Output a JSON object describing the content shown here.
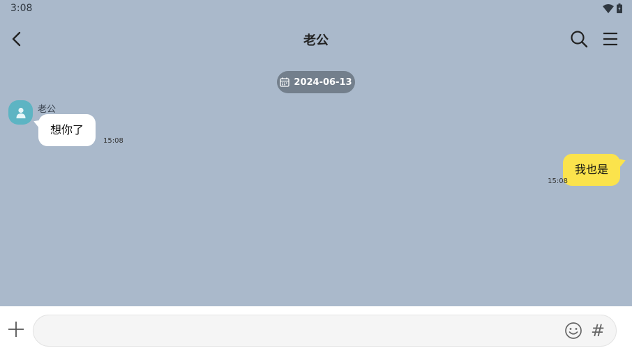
{
  "status_bar": {
    "time": "3:08"
  },
  "header": {
    "title": "老公"
  },
  "chat": {
    "date": "2024-06-13",
    "messages": [
      {
        "direction": "incoming",
        "sender": "老公",
        "text": "想你了",
        "time": "15:08"
      },
      {
        "direction": "outgoing",
        "text": "我也是",
        "time": "15:08"
      }
    ]
  },
  "input": {
    "value": "",
    "placeholder": "",
    "hash_label": "#"
  },
  "icons": {
    "back": "chevron-left-icon",
    "search": "search-icon",
    "menu": "menu-icon",
    "calendar": "calendar-icon",
    "avatar": "person-icon",
    "plus": "plus-icon",
    "emoji": "emoji-icon",
    "wifi": "wifi-icon",
    "battery": "battery-icon"
  },
  "colors": {
    "chat_background": "#aab9cb",
    "incoming_bubble": "#ffffff",
    "outgoing_bubble": "#fbe34c",
    "date_pill": "#737f8c",
    "avatar": "#5db4c3"
  }
}
